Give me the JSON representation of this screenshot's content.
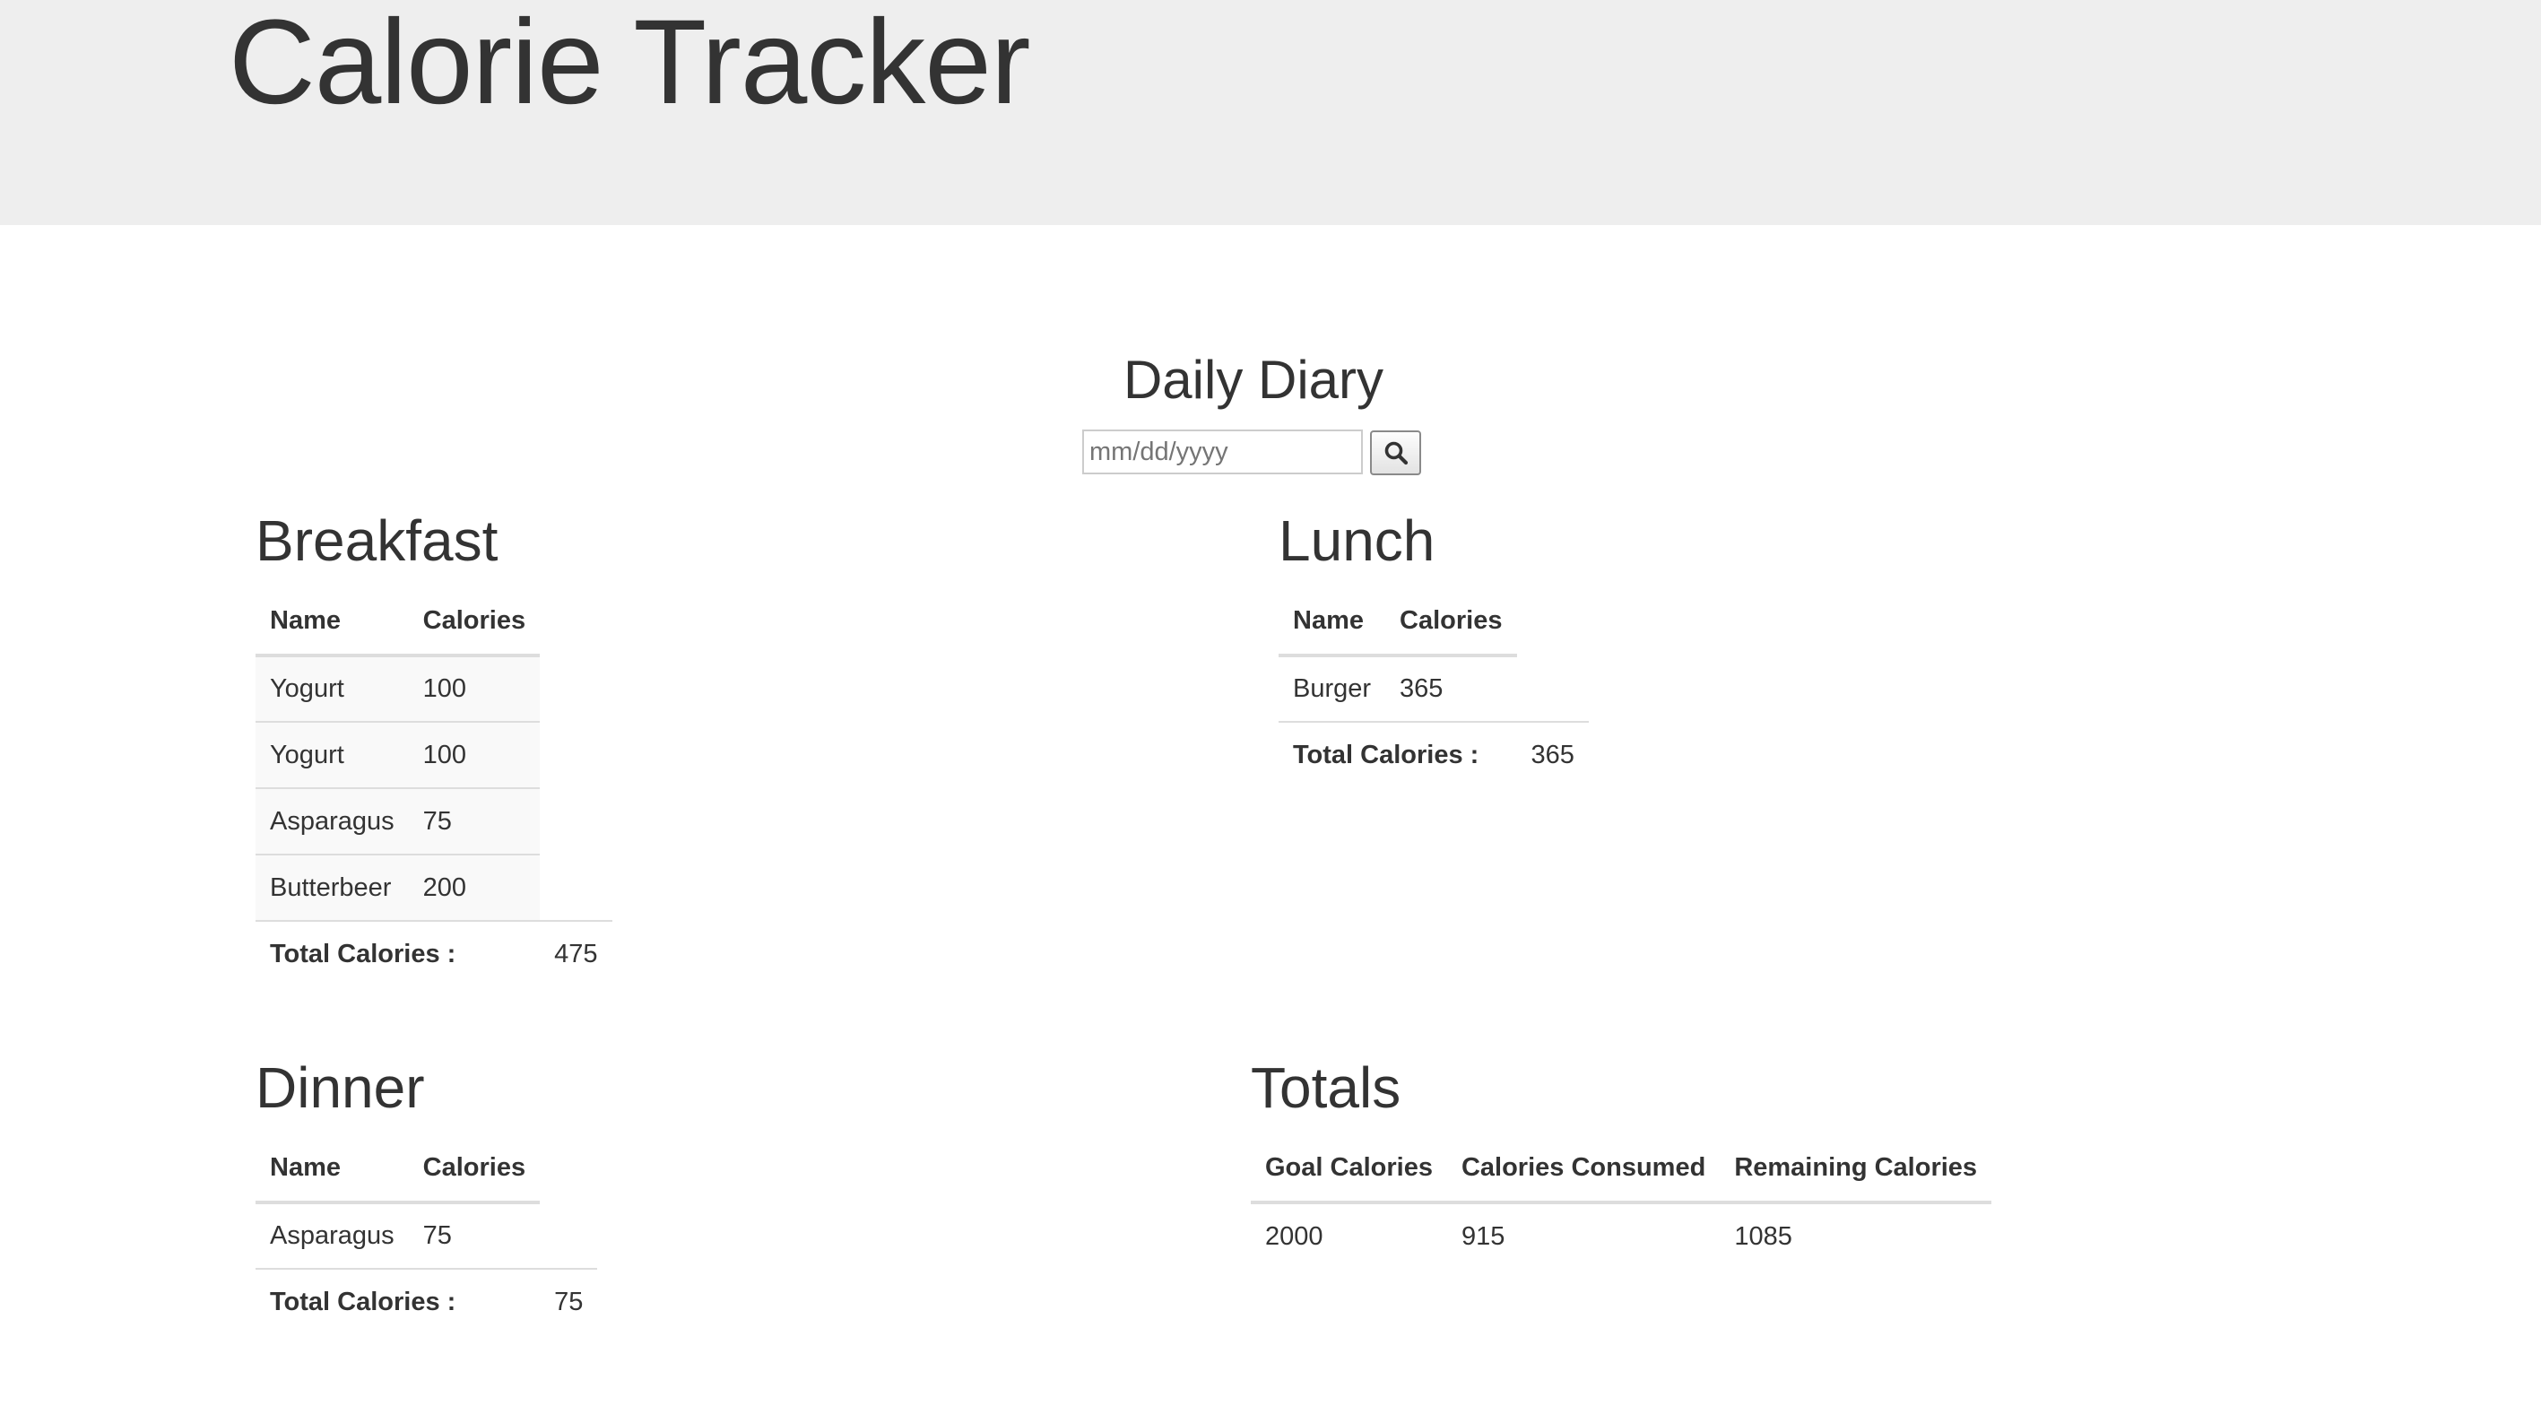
{
  "header": {
    "title": "Calorie Tracker"
  },
  "diary": {
    "title": "Daily Diary",
    "date_placeholder": "mm/dd/yyyy",
    "search_icon": "search-icon"
  },
  "breakfast": {
    "title": "Breakfast",
    "columns": [
      "Name",
      "Calories"
    ],
    "rows": [
      {
        "name": "Yogurt",
        "calories": "100"
      },
      {
        "name": "Yogurt",
        "calories": "100"
      },
      {
        "name": "Asparagus",
        "calories": "75"
      },
      {
        "name": "Butterbeer",
        "calories": "200"
      }
    ],
    "total_label": "Total Calories :",
    "total_value": "475"
  },
  "lunch": {
    "title": "Lunch",
    "columns": [
      "Name",
      "Calories"
    ],
    "rows": [
      {
        "name": "Burger",
        "calories": "365"
      }
    ],
    "total_label": "Total Calories :",
    "total_value": "365"
  },
  "dinner": {
    "title": "Dinner",
    "columns": [
      "Name",
      "Calories"
    ],
    "rows": [
      {
        "name": "Asparagus",
        "calories": "75"
      }
    ],
    "total_label": "Total Calories :",
    "total_value": "75"
  },
  "totals": {
    "title": "Totals",
    "columns": [
      "Goal Calories",
      "Calories Consumed",
      "Remaining Calories"
    ],
    "values": [
      "2000",
      "915",
      "1085"
    ]
  }
}
